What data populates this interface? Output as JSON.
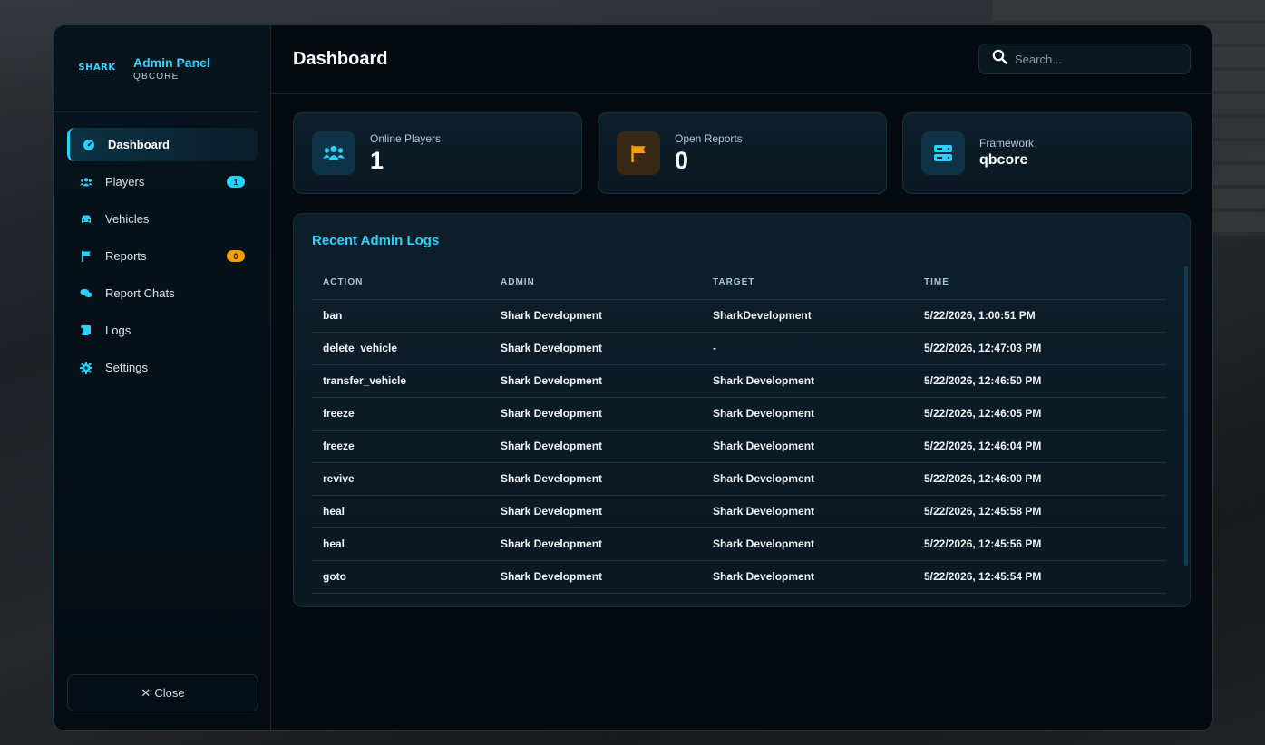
{
  "brand": {
    "logo_text": "SHARK",
    "title": "Admin Panel",
    "subtitle": "QBCORE"
  },
  "sidebar": {
    "items": [
      {
        "label": "Dashboard",
        "icon": "gauge-icon",
        "active": true
      },
      {
        "label": "Players",
        "icon": "users-icon",
        "badge": "1"
      },
      {
        "label": "Vehicles",
        "icon": "car-icon"
      },
      {
        "label": "Reports",
        "icon": "flag-icon",
        "badge": "0"
      },
      {
        "label": "Report Chats",
        "icon": "chat-icon"
      },
      {
        "label": "Logs",
        "icon": "scroll-icon"
      },
      {
        "label": "Settings",
        "icon": "gear-icon"
      }
    ],
    "close_label": "Close"
  },
  "header": {
    "title": "Dashboard",
    "search_placeholder": "Search..."
  },
  "stats": [
    {
      "label": "Online Players",
      "value": "1",
      "icon": "users-icon"
    },
    {
      "label": "Open Reports",
      "value": "0",
      "icon": "flag-icon"
    },
    {
      "label": "Framework",
      "value": "qbcore",
      "icon": "server-icon"
    }
  ],
  "logs": {
    "title": "Recent Admin Logs",
    "columns": [
      "ACTION",
      "ADMIN",
      "TARGET",
      "TIME"
    ],
    "rows": [
      [
        "ban",
        "Shark Development",
        "SharkDevelopment",
        "5/22/2026, 1:00:51 PM"
      ],
      [
        "delete_vehicle",
        "Shark Development",
        "-",
        "5/22/2026, 12:47:03 PM"
      ],
      [
        "transfer_vehicle",
        "Shark Development",
        "Shark Development",
        "5/22/2026, 12:46:50 PM"
      ],
      [
        "freeze",
        "Shark Development",
        "Shark Development",
        "5/22/2026, 12:46:05 PM"
      ],
      [
        "freeze",
        "Shark Development",
        "Shark Development",
        "5/22/2026, 12:46:04 PM"
      ],
      [
        "revive",
        "Shark Development",
        "Shark Development",
        "5/22/2026, 12:46:00 PM"
      ],
      [
        "heal",
        "Shark Development",
        "Shark Development",
        "5/22/2026, 12:45:58 PM"
      ],
      [
        "heal",
        "Shark Development",
        "Shark Development",
        "5/22/2026, 12:45:56 PM"
      ],
      [
        "goto",
        "Shark Development",
        "Shark Development",
        "5/22/2026, 12:45:54 PM"
      ]
    ]
  },
  "colors": {
    "accent": "#2fd2ff",
    "badge_cyan": "#26d2f5",
    "badge_orange": "#f59e0b",
    "panel_bg": "#050a10"
  }
}
